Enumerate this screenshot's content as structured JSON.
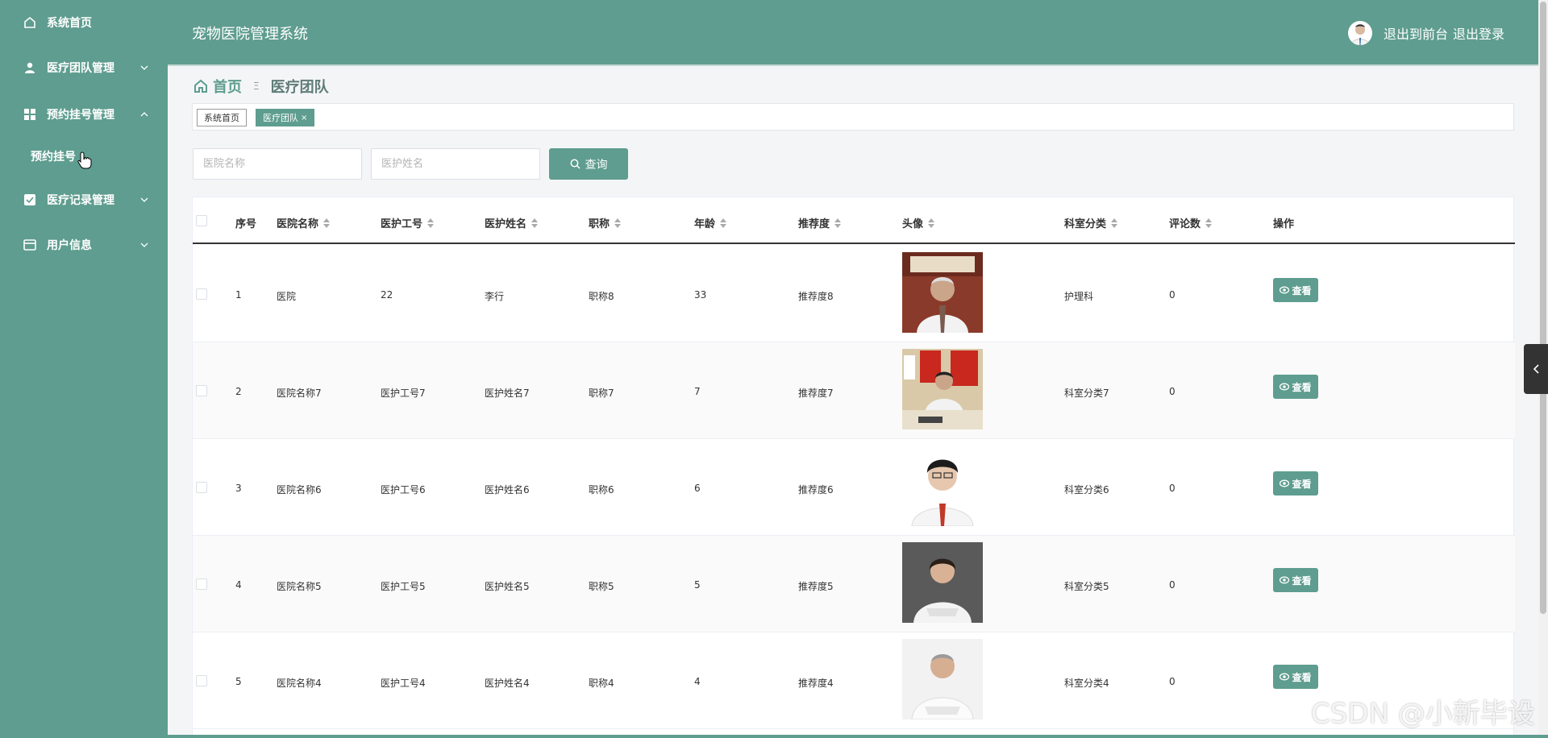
{
  "header": {
    "app_title": "宠物医院管理系统",
    "link_front": "退出到前台",
    "link_logout": "退出登录"
  },
  "sidebar": {
    "items": [
      {
        "label": "系统首页",
        "icon": "home-icon"
      },
      {
        "label": "医疗团队管理",
        "icon": "user-icon"
      },
      {
        "label": "预约挂号管理",
        "icon": "grid-icon"
      },
      {
        "label": "医疗记录管理",
        "icon": "checkbox-icon"
      },
      {
        "label": "用户信息",
        "icon": "card-icon"
      }
    ],
    "sub_item": "预约挂号"
  },
  "breadcrumb": {
    "home": "首页",
    "separator": "Ξ",
    "current": "医疗团队"
  },
  "tags": {
    "home": "系统首页",
    "active": "医疗团队",
    "close": "×"
  },
  "search": {
    "hospital_placeholder": "医院名称",
    "nurse_placeholder": "医护姓名",
    "button": "查询"
  },
  "table": {
    "headers": [
      "序号",
      "医院名称",
      "医护工号",
      "医护姓名",
      "职称",
      "年龄",
      "推荐度",
      "头像",
      "科室分类",
      "评论数",
      "操作"
    ],
    "view_label": "查看",
    "rows": [
      {
        "no": "1",
        "hospital": "医院",
        "job_no": "22",
        "name": "李行",
        "title": "职称8",
        "age": "33",
        "rec": "推荐度8",
        "dept": "护理科",
        "comments": "0"
      },
      {
        "no": "2",
        "hospital": "医院名称7",
        "job_no": "医护工号7",
        "name": "医护姓名7",
        "title": "职称7",
        "age": "7",
        "rec": "推荐度7",
        "dept": "科室分类7",
        "comments": "0"
      },
      {
        "no": "3",
        "hospital": "医院名称6",
        "job_no": "医护工号6",
        "name": "医护姓名6",
        "title": "职称6",
        "age": "6",
        "rec": "推荐度6",
        "dept": "科室分类6",
        "comments": "0"
      },
      {
        "no": "4",
        "hospital": "医院名称5",
        "job_no": "医护工号5",
        "name": "医护姓名5",
        "title": "职称5",
        "age": "5",
        "rec": "推荐度5",
        "dept": "科室分类5",
        "comments": "0"
      },
      {
        "no": "5",
        "hospital": "医院名称4",
        "job_no": "医护工号4",
        "name": "医护姓名4",
        "title": "职称4",
        "age": "4",
        "rec": "推荐度4",
        "dept": "科室分类4",
        "comments": "0"
      }
    ]
  },
  "watermark": "CSDN @小新毕设",
  "colors": {
    "primary": "#5e9d8f",
    "text": "#333333"
  }
}
